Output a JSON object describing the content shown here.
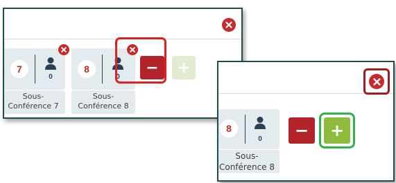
{
  "colors": {
    "accent_red": "#c62a2a",
    "panel_border": "#1e4d4b",
    "card_bg": "#e4ebee",
    "plus_green": "#8dbb3c",
    "highlight_red": "#e02020",
    "highlight_green": "#2eb34a"
  },
  "main_panel": {
    "conferences": [
      {
        "number": "7",
        "participants": "0",
        "label_line1": "Sous-",
        "label_line2": "Conférence 7"
      },
      {
        "number": "8",
        "participants": "0",
        "label_line1": "Sous-",
        "label_line2": "Conférence 8"
      }
    ],
    "remove_button_label": "−",
    "add_button_label": "+",
    "add_button_state": "disabled"
  },
  "zoom_panel": {
    "conference": {
      "number": "8",
      "participants": "0",
      "label_line1": "Sous-",
      "label_line2": "Conférence 8"
    },
    "remove_button_label": "−",
    "add_button_label": "+",
    "add_button_state": "enabled"
  },
  "icons": [
    "close-circle-icon",
    "person-icon",
    "minus-icon",
    "plus-icon"
  ]
}
